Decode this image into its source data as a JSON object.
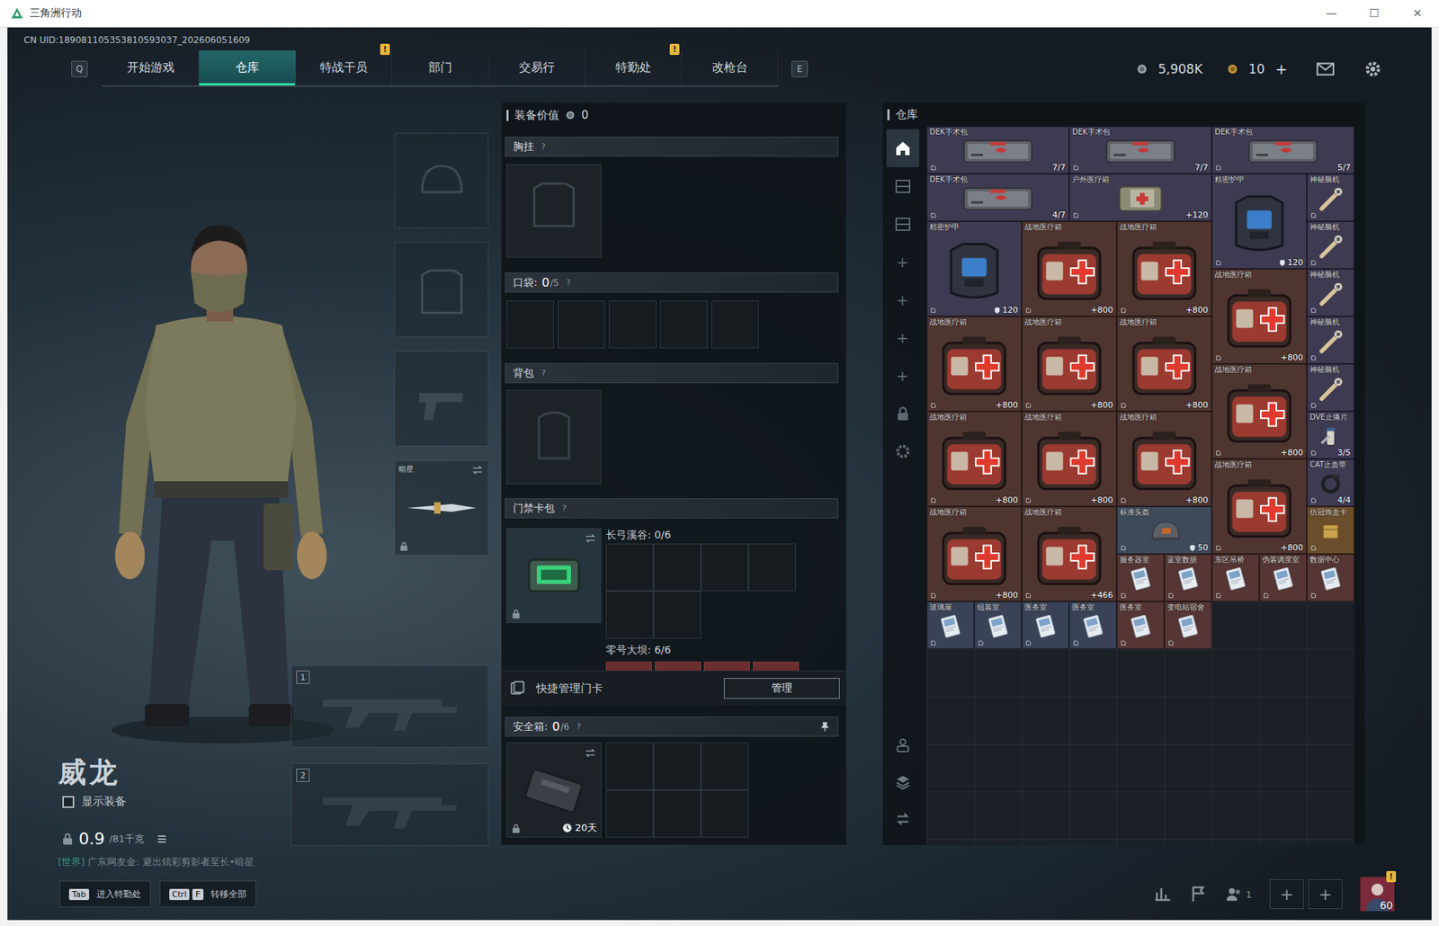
{
  "window": {
    "title": "三角洲行动",
    "controls": [
      "—",
      "☐",
      "✕"
    ]
  },
  "uid": "CN UID:189081105353810593037_202606051609",
  "nav": {
    "keys": [
      "Q",
      "E"
    ],
    "tabs": [
      {
        "label": "开始游戏",
        "selected": false,
        "badge": ""
      },
      {
        "label": "仓库",
        "selected": true,
        "badge": ""
      },
      {
        "label": "特战干员",
        "selected": false,
        "badge": "!"
      },
      {
        "label": "部门",
        "selected": false,
        "badge": ""
      },
      {
        "label": "交易行",
        "selected": false,
        "badge": ""
      },
      {
        "label": "特勤处",
        "selected": false,
        "badge": "!"
      },
      {
        "label": "改枪台",
        "selected": false,
        "badge": ""
      }
    ]
  },
  "currency": {
    "coins": "5,908K",
    "tickets": "10",
    "add": "+"
  },
  "operator": {
    "name": "威龙",
    "show_gear": {
      "label": "显示装备",
      "checked": false
    },
    "weight": "0.9",
    "capacity": "/81千克"
  },
  "chat": {
    "channel": "[世界]",
    "text": "广东网友金: 避出炫彩剪影者至长•暗星"
  },
  "loadout": {
    "melee": {
      "label": "暗星",
      "locked": true
    },
    "weapon_slots": [
      "1",
      "2"
    ]
  },
  "equipment": {
    "value_label": "装备价值",
    "value": "0",
    "help": "?",
    "chest_rig": "胸挂",
    "pockets": {
      "label": "口袋:",
      "used": "0",
      "total": "/5"
    },
    "backpack": "背包",
    "keycard_bag": {
      "label": "门禁卡包",
      "locked": true,
      "maps": [
        {
          "name": "长弓溪谷: 0/6"
        },
        {
          "name": "零号大坝: 6/6"
        }
      ]
    },
    "quick_manage": {
      "label": "快捷管理门卡",
      "button": "管理"
    },
    "safe": {
      "label": "安全箱:",
      "used": "0",
      "total": "/6",
      "locked": true,
      "time": "20天"
    }
  },
  "warehouse": {
    "title": "仓库",
    "tabs": [
      {
        "kind": "home",
        "label": "",
        "selected": true
      },
      {
        "kind": "shelf",
        "label": "",
        "selected": false
      },
      {
        "kind": "shelf",
        "label": "",
        "selected": false
      },
      {
        "kind": "add",
        "label": "+",
        "selected": false
      },
      {
        "kind": "add",
        "label": "+",
        "selected": false
      },
      {
        "kind": "add",
        "label": "+",
        "selected": false
      },
      {
        "kind": "add",
        "label": "+",
        "selected": false
      },
      {
        "kind": "lock",
        "label": "",
        "selected": false
      },
      {
        "kind": "gear",
        "label": "",
        "selected": false
      }
    ],
    "tools": [
      {
        "kind": "person"
      },
      {
        "kind": "layers"
      },
      {
        "kind": "transfer"
      }
    ],
    "items": [
      {
        "name": "DEK手术包",
        "value": "7/7",
        "kind": "surgery",
        "color": "#3e3a52"
      },
      {
        "name": "DEK手术包",
        "value": "7/7",
        "kind": "surgery",
        "color": "#3e3a52"
      },
      {
        "name": "DEK手术包",
        "value": "5/7",
        "kind": "surgery",
        "color": "#3e3a52"
      },
      {
        "name": "DEK手术包",
        "value": "4/7",
        "kind": "surgery",
        "color": "#3e3a52"
      },
      {
        "name": "户外医疗箱",
        "value": "+120",
        "kind": "box",
        "color": "#3e3a52"
      },
      {
        "name": "精密护甲",
        "value": "120",
        "kind": "armor",
        "color": "#3e3a52"
      },
      {
        "name": "神秘脑机",
        "value": "",
        "kind": "injector",
        "color": "#3e3a52"
      },
      {
        "name": "精密护甲",
        "value": "120",
        "kind": "armor",
        "color": "#3e3a52"
      },
      {
        "name": "战地医疗箱",
        "value": "+800",
        "kind": "medkit",
        "color": "#4f3530"
      },
      {
        "name": "战地医疗箱",
        "value": "+800",
        "kind": "medkit",
        "color": "#4f3530"
      },
      {
        "name": "神秘脑机",
        "value": "",
        "kind": "injector",
        "color": "#3e3a52"
      },
      {
        "name": "战地医疗箱",
        "value": "+800",
        "kind": "medkit",
        "color": "#4f3530"
      },
      {
        "name": "神秘脑机",
        "value": "",
        "kind": "injector",
        "color": "#3e3a52"
      },
      {
        "name": "战地医疗箱",
        "value": "+800",
        "kind": "medkit",
        "color": "#4f3530"
      },
      {
        "name": "战地医疗箱",
        "value": "+800",
        "kind": "medkit",
        "color": "#4f3530"
      },
      {
        "name": "战地医疗箱",
        "value": "+800",
        "kind": "medkit",
        "color": "#4f3530"
      },
      {
        "name": "神秘脑机",
        "value": "",
        "kind": "injector",
        "color": "#3e3a52"
      },
      {
        "name": "战地医疗箱",
        "value": "+800",
        "kind": "medkit",
        "color": "#4f3530"
      },
      {
        "name": "神秘脑机",
        "value": "",
        "kind": "injector",
        "color": "#3e3a52"
      },
      {
        "name": "战地医疗箱",
        "value": "+800",
        "kind": "medkit",
        "color": "#4f3530"
      },
      {
        "name": "战地医疗箱",
        "value": "+800",
        "kind": "medkit",
        "color": "#4f3530"
      },
      {
        "name": "战地医疗箱",
        "value": "+800",
        "kind": "medkit",
        "color": "#4f3530"
      },
      {
        "name": "DVE止痛片",
        "value": "3/5",
        "kind": "pill",
        "color": "#3e3a52"
      },
      {
        "name": "战地医疗箱",
        "value": "+800",
        "kind": "medkit",
        "color": "#4f3530"
      },
      {
        "name": "CAT止血带",
        "value": "4/4",
        "kind": "tourniquet",
        "color": "#3e3a52"
      },
      {
        "name": "战地医疗箱",
        "value": "+800",
        "kind": "medkit",
        "color": "#4f3530"
      },
      {
        "name": "战地医疗箱",
        "value": "+466",
        "kind": "medkit",
        "color": "#4f3530"
      },
      {
        "name": "标准头盔",
        "value": "50",
        "kind": "helmet",
        "color": "#3e4a5a"
      },
      {
        "name": "仿冠饰盒卡",
        "value": "",
        "kind": "relic",
        "color": "#6a4d2a"
      },
      {
        "name": "服务器室",
        "value": "",
        "kind": "key",
        "color": "#553634"
      },
      {
        "name": "蓝室数据",
        "value": "",
        "kind": "key",
        "color": "#553634"
      },
      {
        "name": "东区吊桥",
        "value": "",
        "kind": "key",
        "color": "#553634"
      },
      {
        "name": "伪装调度室",
        "value": "",
        "kind": "key",
        "color": "#553634"
      },
      {
        "name": "数据中心",
        "value": "",
        "kind": "key",
        "color": "#553634"
      },
      {
        "name": "玻璃屋",
        "value": "",
        "kind": "key",
        "color": "#394257"
      },
      {
        "name": "组装室",
        "value": "",
        "kind": "key",
        "color": "#394257"
      },
      {
        "name": "医务室",
        "value": "",
        "kind": "key",
        "color": "#394257"
      },
      {
        "name": "医务室",
        "value": "",
        "kind": "key",
        "color": "#394257"
      },
      {
        "name": "医务室",
        "value": "",
        "kind": "key",
        "color": "#553634"
      },
      {
        "name": "变电站宿舍",
        "value": "",
        "kind": "key",
        "color": "#553634"
      }
    ]
  },
  "bottom": {
    "hints": [
      {
        "keys": [
          "Tab"
        ],
        "label": "进入特勤处"
      },
      {
        "keys": [
          "Ctrl",
          "F"
        ],
        "label": "转移全部"
      }
    ],
    "friends": "1",
    "slots": [
      "+",
      "+"
    ],
    "level": "60",
    "badge": "!"
  }
}
